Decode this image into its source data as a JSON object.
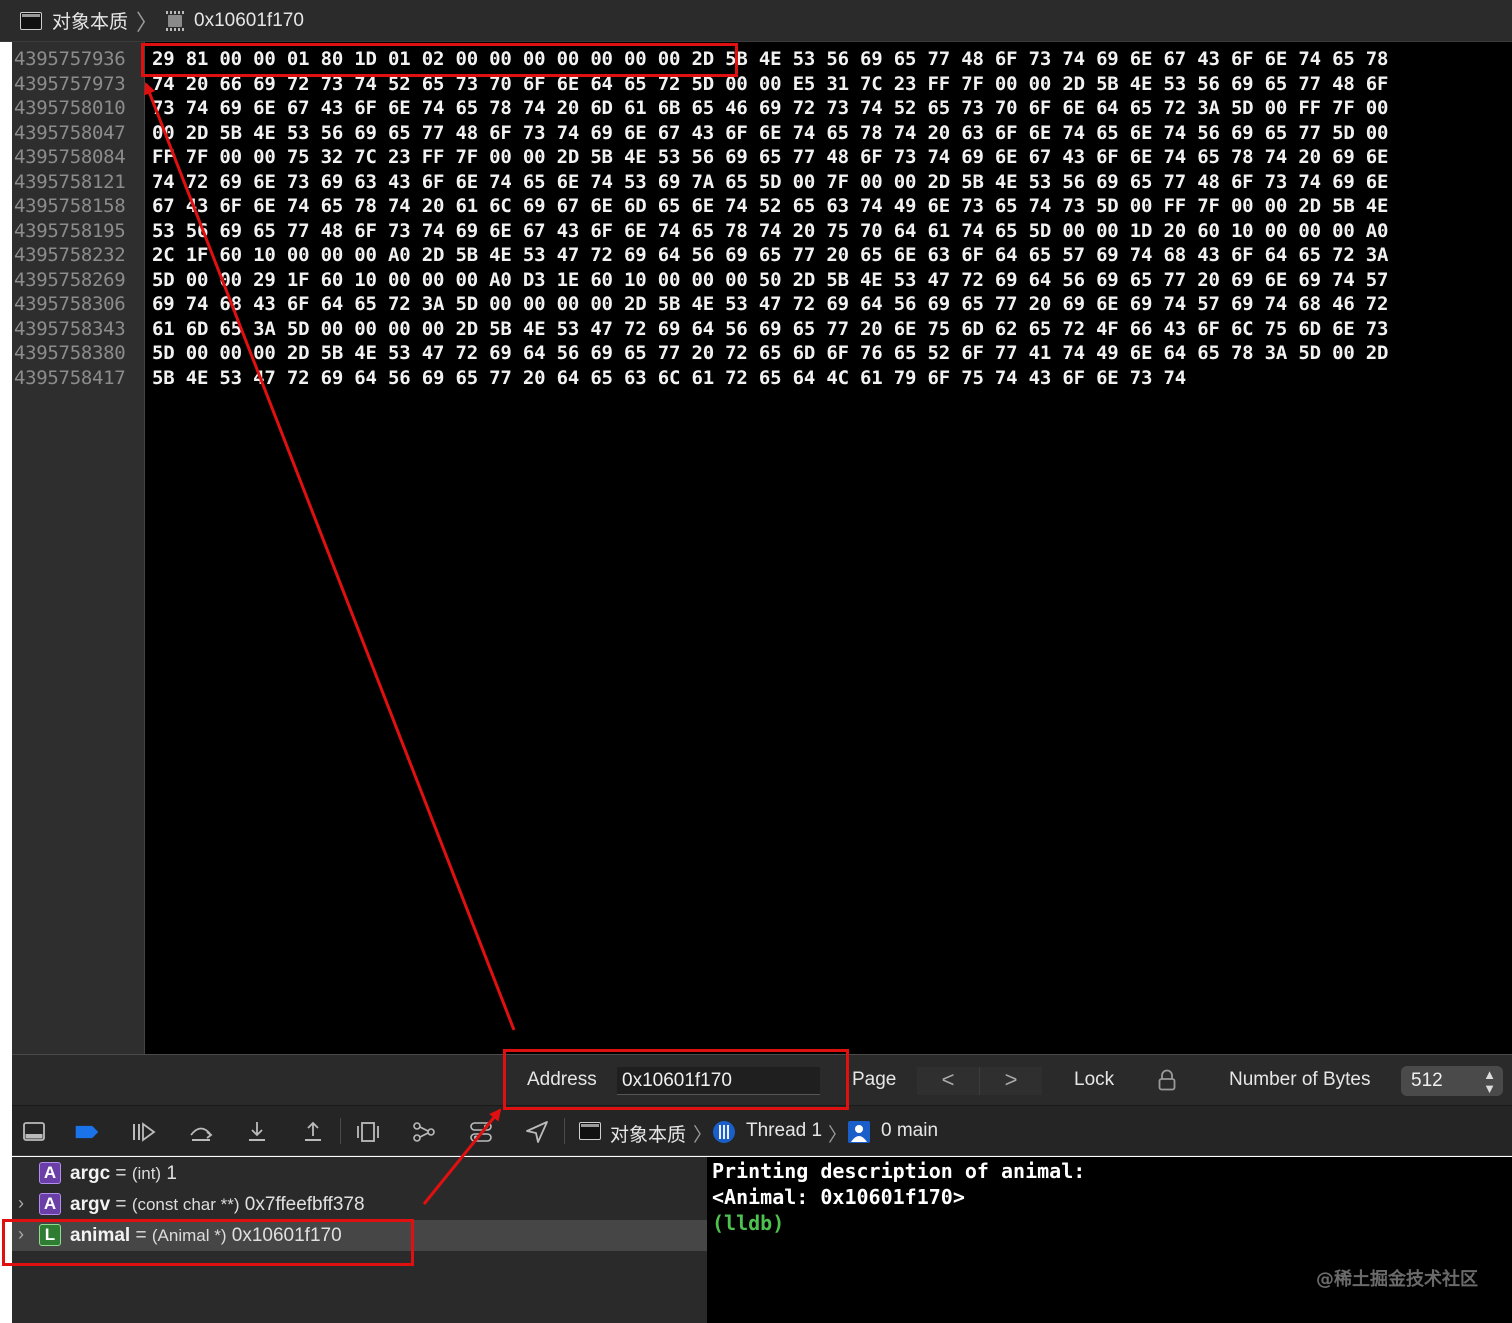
{
  "breadcrumb": {
    "project": "对象本质",
    "location": "0x10601f170"
  },
  "memory": {
    "rows": [
      {
        "address": "4395757936",
        "bytes": "29 81 00 00 01 80 1D 01 02 00 00 00 00 00 00 00 2D 5B 4E 53 56 69 65 77 48 6F 73 74 69 6E 67 43 6F 6E 74 65 78"
      },
      {
        "address": "4395757973",
        "bytes": "74 20 66 69 72 73 74 52 65 73 70 6F 6E 64 65 72 5D 00 00 E5 31 7C 23 FF 7F 00 00 2D 5B 4E 53 56 69 65 77 48 6F"
      },
      {
        "address": "4395758010",
        "bytes": "73 74 69 6E 67 43 6F 6E 74 65 78 74 20 6D 61 6B 65 46 69 72 73 74 52 65 73 70 6F 6E 64 65 72 3A 5D 00 FF 7F 00"
      },
      {
        "address": "4395758047",
        "bytes": "00 2D 5B 4E 53 56 69 65 77 48 6F 73 74 69 6E 67 43 6F 6E 74 65 78 74 20 63 6F 6E 74 65 6E 74 56 69 65 77 5D 00"
      },
      {
        "address": "4395758084",
        "bytes": "FF 7F 00 00 75 32 7C 23 FF 7F 00 00 2D 5B 4E 53 56 69 65 77 48 6F 73 74 69 6E 67 43 6F 6E 74 65 78 74 20 69 6E"
      },
      {
        "address": "4395758121",
        "bytes": "74 72 69 6E 73 69 63 43 6F 6E 74 65 6E 74 53 69 7A 65 5D 00 7F 00 00 2D 5B 4E 53 56 69 65 77 48 6F 73 74 69 6E"
      },
      {
        "address": "4395758158",
        "bytes": "67 43 6F 6E 74 65 78 74 20 61 6C 69 67 6E 6D 65 6E 74 52 65 63 74 49 6E 73 65 74 73 5D 00 FF 7F 00 00 2D 5B 4E"
      },
      {
        "address": "4395758195",
        "bytes": "53 56 69 65 77 48 6F 73 74 69 6E 67 43 6F 6E 74 65 78 74 20 75 70 64 61 74 65 5D 00 00 1D 20 60 10 00 00 00 A0"
      },
      {
        "address": "4395758232",
        "bytes": "2C 1F 60 10 00 00 00 A0 2D 5B 4E 53 47 72 69 64 56 69 65 77 20 65 6E 63 6F 64 65 57 69 74 68 43 6F 64 65 72 3A"
      },
      {
        "address": "4395758269",
        "bytes": "5D 00 00 29 1F 60 10 00 00 00 A0 D3 1E 60 10 00 00 00 50 2D 5B 4E 53 47 72 69 64 56 69 65 77 20 69 6E 69 74 57"
      },
      {
        "address": "4395758306",
        "bytes": "69 74 68 43 6F 64 65 72 3A 5D 00 00 00 00 2D 5B 4E 53 47 72 69 64 56 69 65 77 20 69 6E 69 74 57 69 74 68 46 72"
      },
      {
        "address": "4395758343",
        "bytes": "61 6D 65 3A 5D 00 00 00 00 2D 5B 4E 53 47 72 69 64 56 69 65 77 20 6E 75 6D 62 65 72 4F 66 43 6F 6C 75 6D 6E 73"
      },
      {
        "address": "4395758380",
        "bytes": "5D 00 00 00 2D 5B 4E 53 47 72 69 64 56 69 65 77 20 72 65 6D 6F 76 65 52 6F 77 41 74 49 6E 64 65 78 3A 5D 00 2D"
      },
      {
        "address": "4395758417",
        "bytes": "5B 4E 53 47 72 69 64 56 69 65 77 20 64 65 63 6C 61 72 65 64 4C 61 79 6F 75 74 43 6F 6E 73 74"
      }
    ]
  },
  "address_bar": {
    "address_label": "Address",
    "address_value": "0x10601f170",
    "page_label": "Page",
    "prev": "<",
    "next": ">",
    "lock_label": "Lock",
    "bytes_label": "Number of Bytes",
    "bytes_value": "512"
  },
  "debug_bar": {
    "target": "对象本质",
    "thread": "Thread 1",
    "frame": "0 main"
  },
  "variables": [
    {
      "badge": "A",
      "name": "argc",
      "eq": "=",
      "type": "(int)",
      "value": "1",
      "expandable": false
    },
    {
      "badge": "A",
      "name": "argv",
      "eq": "=",
      "type": "(const char **)",
      "value": "0x7ffeefbff378",
      "expandable": true
    },
    {
      "badge": "L",
      "name": "animal",
      "eq": "=",
      "type": "(Animal *)",
      "value": "0x10601f170",
      "expandable": true
    }
  ],
  "console": {
    "lines": [
      "Printing description of animal:",
      "<Animal: 0x10601f170>"
    ],
    "prompt": "(lldb)"
  },
  "watermark": "@稀土掘金技术社区",
  "colors": {
    "annotation_red": "#e01010",
    "lldb_prompt": "#4ec24e",
    "arg_badge": "#6a3fa8",
    "local_badge": "#2f7d32"
  }
}
